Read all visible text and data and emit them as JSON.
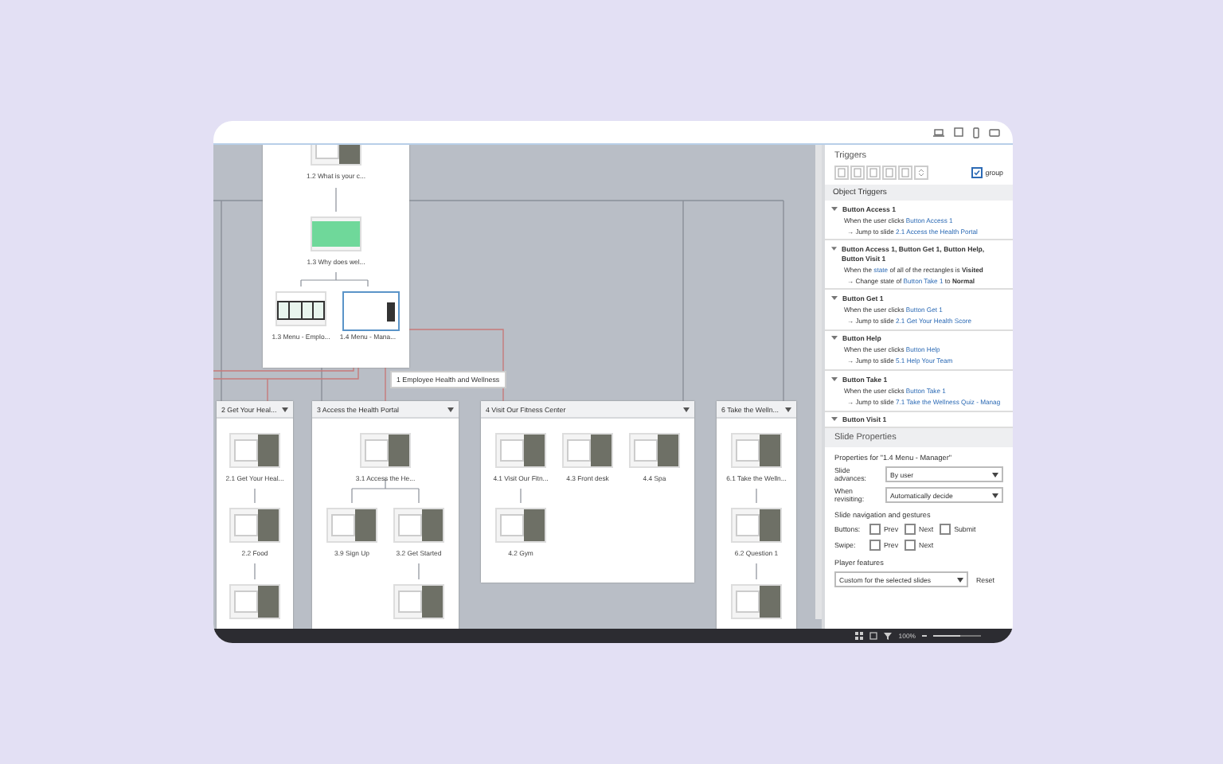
{
  "canvas": {
    "tooltip": "1 Employee Health and Wellness",
    "scenes": [
      {
        "slides": [
          {
            "label": "1.2 What is your c...",
            "kind": "photo",
            "selected": false
          },
          {
            "label": "1.3 Why does wel...",
            "kind": "green",
            "selected": false
          },
          {
            "label": "1.3 Menu - Emplo...",
            "kind": "menu",
            "selected": false
          },
          {
            "label": "1.4 Menu - Mana...",
            "kind": "menu",
            "selected": true
          }
        ]
      },
      {
        "title": "2 Get Your Heal...",
        "slides": [
          {
            "label": "2.1 Get Your Heal...",
            "kind": "photo",
            "selected": false
          },
          {
            "label": "2.2 Food",
            "kind": "photo",
            "selected": false
          },
          {
            "kind": "photo",
            "selected": false
          }
        ]
      },
      {
        "title": "3 Access the Health Portal",
        "slides": [
          {
            "label": "3.1 Access the He...",
            "kind": "photo",
            "selected": false
          },
          {
            "label": "3.9 Sign Up",
            "kind": "photo",
            "selected": false
          },
          {
            "label": "3.2 Get Started",
            "kind": "photo",
            "selected": false
          },
          {
            "kind": "photo",
            "selected": false
          }
        ]
      },
      {
        "title": "4 Visit Our Fitness Center",
        "slides": [
          {
            "label": "4.1 Visit Our Fitn...",
            "kind": "photo",
            "selected": false
          },
          {
            "label": "4.2 Gym",
            "kind": "photo",
            "selected": false
          },
          {
            "label": "4.3 Front desk",
            "kind": "photo",
            "selected": false
          },
          {
            "label": "4.4 Spa",
            "kind": "photo",
            "selected": false
          }
        ]
      },
      {
        "title": "6 Take the Welln...",
        "slides": [
          {
            "label": "6.1 Take the Welln...",
            "kind": "photo",
            "selected": false
          },
          {
            "label": "6.2 Question 1",
            "kind": "photo",
            "selected": false
          },
          {
            "kind": "photo",
            "selected": false
          }
        ]
      }
    ]
  },
  "triggers": {
    "title": "Triggers",
    "group": {
      "label": "group",
      "checked": true
    },
    "section": "Object Triggers",
    "items": [
      {
        "name": "Button Access 1",
        "expanded": true,
        "condition": [
          {
            "kind": "text",
            "t": "When the user clicks"
          },
          {
            "kind": "ref",
            "t": "Button Access 1"
          }
        ],
        "action": [
          {
            "kind": "text",
            "t": "→ Jump to slide"
          },
          {
            "kind": "ref",
            "t": "2.1 Access the Health Portal"
          }
        ]
      },
      {
        "name": "Button Access 1, Button Get 1, Button Help, Button Visit 1",
        "expanded": true,
        "condition": [
          {
            "kind": "text",
            "t": "When the"
          },
          {
            "kind": "ref",
            "t": "state"
          },
          {
            "kind": "text",
            "t": "of all of the rectangles is"
          },
          {
            "kind": "bold",
            "t": "Visited"
          }
        ],
        "action": [
          {
            "kind": "text",
            "t": "→ Change state of"
          },
          {
            "kind": "ref",
            "t": "Button Take 1"
          },
          {
            "kind": "text",
            "t": "to"
          },
          {
            "kind": "bold",
            "t": "Normal"
          }
        ]
      },
      {
        "name": "Button Get 1",
        "expanded": true,
        "condition": [
          {
            "kind": "text",
            "t": "When the user clicks"
          },
          {
            "kind": "ref",
            "t": "Button Get 1"
          }
        ],
        "action": [
          {
            "kind": "text",
            "t": "→ Jump to slide"
          },
          {
            "kind": "ref",
            "t": "2.1 Get Your Health Score"
          }
        ]
      },
      {
        "name": "Button Help",
        "expanded": true,
        "condition": [
          {
            "kind": "text",
            "t": "When the user clicks"
          },
          {
            "kind": "ref",
            "t": "Button Help"
          }
        ],
        "action": [
          {
            "kind": "text",
            "t": "→ Jump to slide"
          },
          {
            "kind": "ref",
            "t": "5.1 Help Your Team"
          }
        ]
      },
      {
        "name": "Button Take 1",
        "expanded": true,
        "condition": [
          {
            "kind": "text",
            "t": "When the user clicks"
          },
          {
            "kind": "ref",
            "t": "Button Take 1"
          }
        ],
        "action": [
          {
            "kind": "text",
            "t": "→ Jump to slide"
          },
          {
            "kind": "ref",
            "t": "7.1 Take the Wellness Quiz - Manag"
          }
        ]
      },
      {
        "name": "Button Visit 1",
        "expanded": true
      }
    ]
  },
  "slide_properties": {
    "title": "Slide Properties",
    "heading": "Properties for \"1.4 Menu - Manager\"",
    "fields": [
      {
        "label": "Slide advances:",
        "value": "By user"
      },
      {
        "label": "When revisiting:",
        "value": "Automatically decide"
      }
    ],
    "nav_heading": "Slide navigation and gestures",
    "nav_rows": [
      {
        "label": "Buttons:",
        "options": [
          {
            "label": "Prev",
            "checked": false
          },
          {
            "label": "Next",
            "checked": false
          },
          {
            "label": "Submit",
            "checked": false
          }
        ]
      },
      {
        "label": "Swipe:",
        "options": [
          {
            "label": "Prev",
            "checked": false
          },
          {
            "label": "Next",
            "checked": false
          }
        ]
      }
    ],
    "player_heading": "Player features",
    "player_select": "Custom for the selected slides",
    "reset": "Reset"
  },
  "taskbar": {
    "zoom": {
      "reading": "100%",
      "level": 0.55
    }
  }
}
